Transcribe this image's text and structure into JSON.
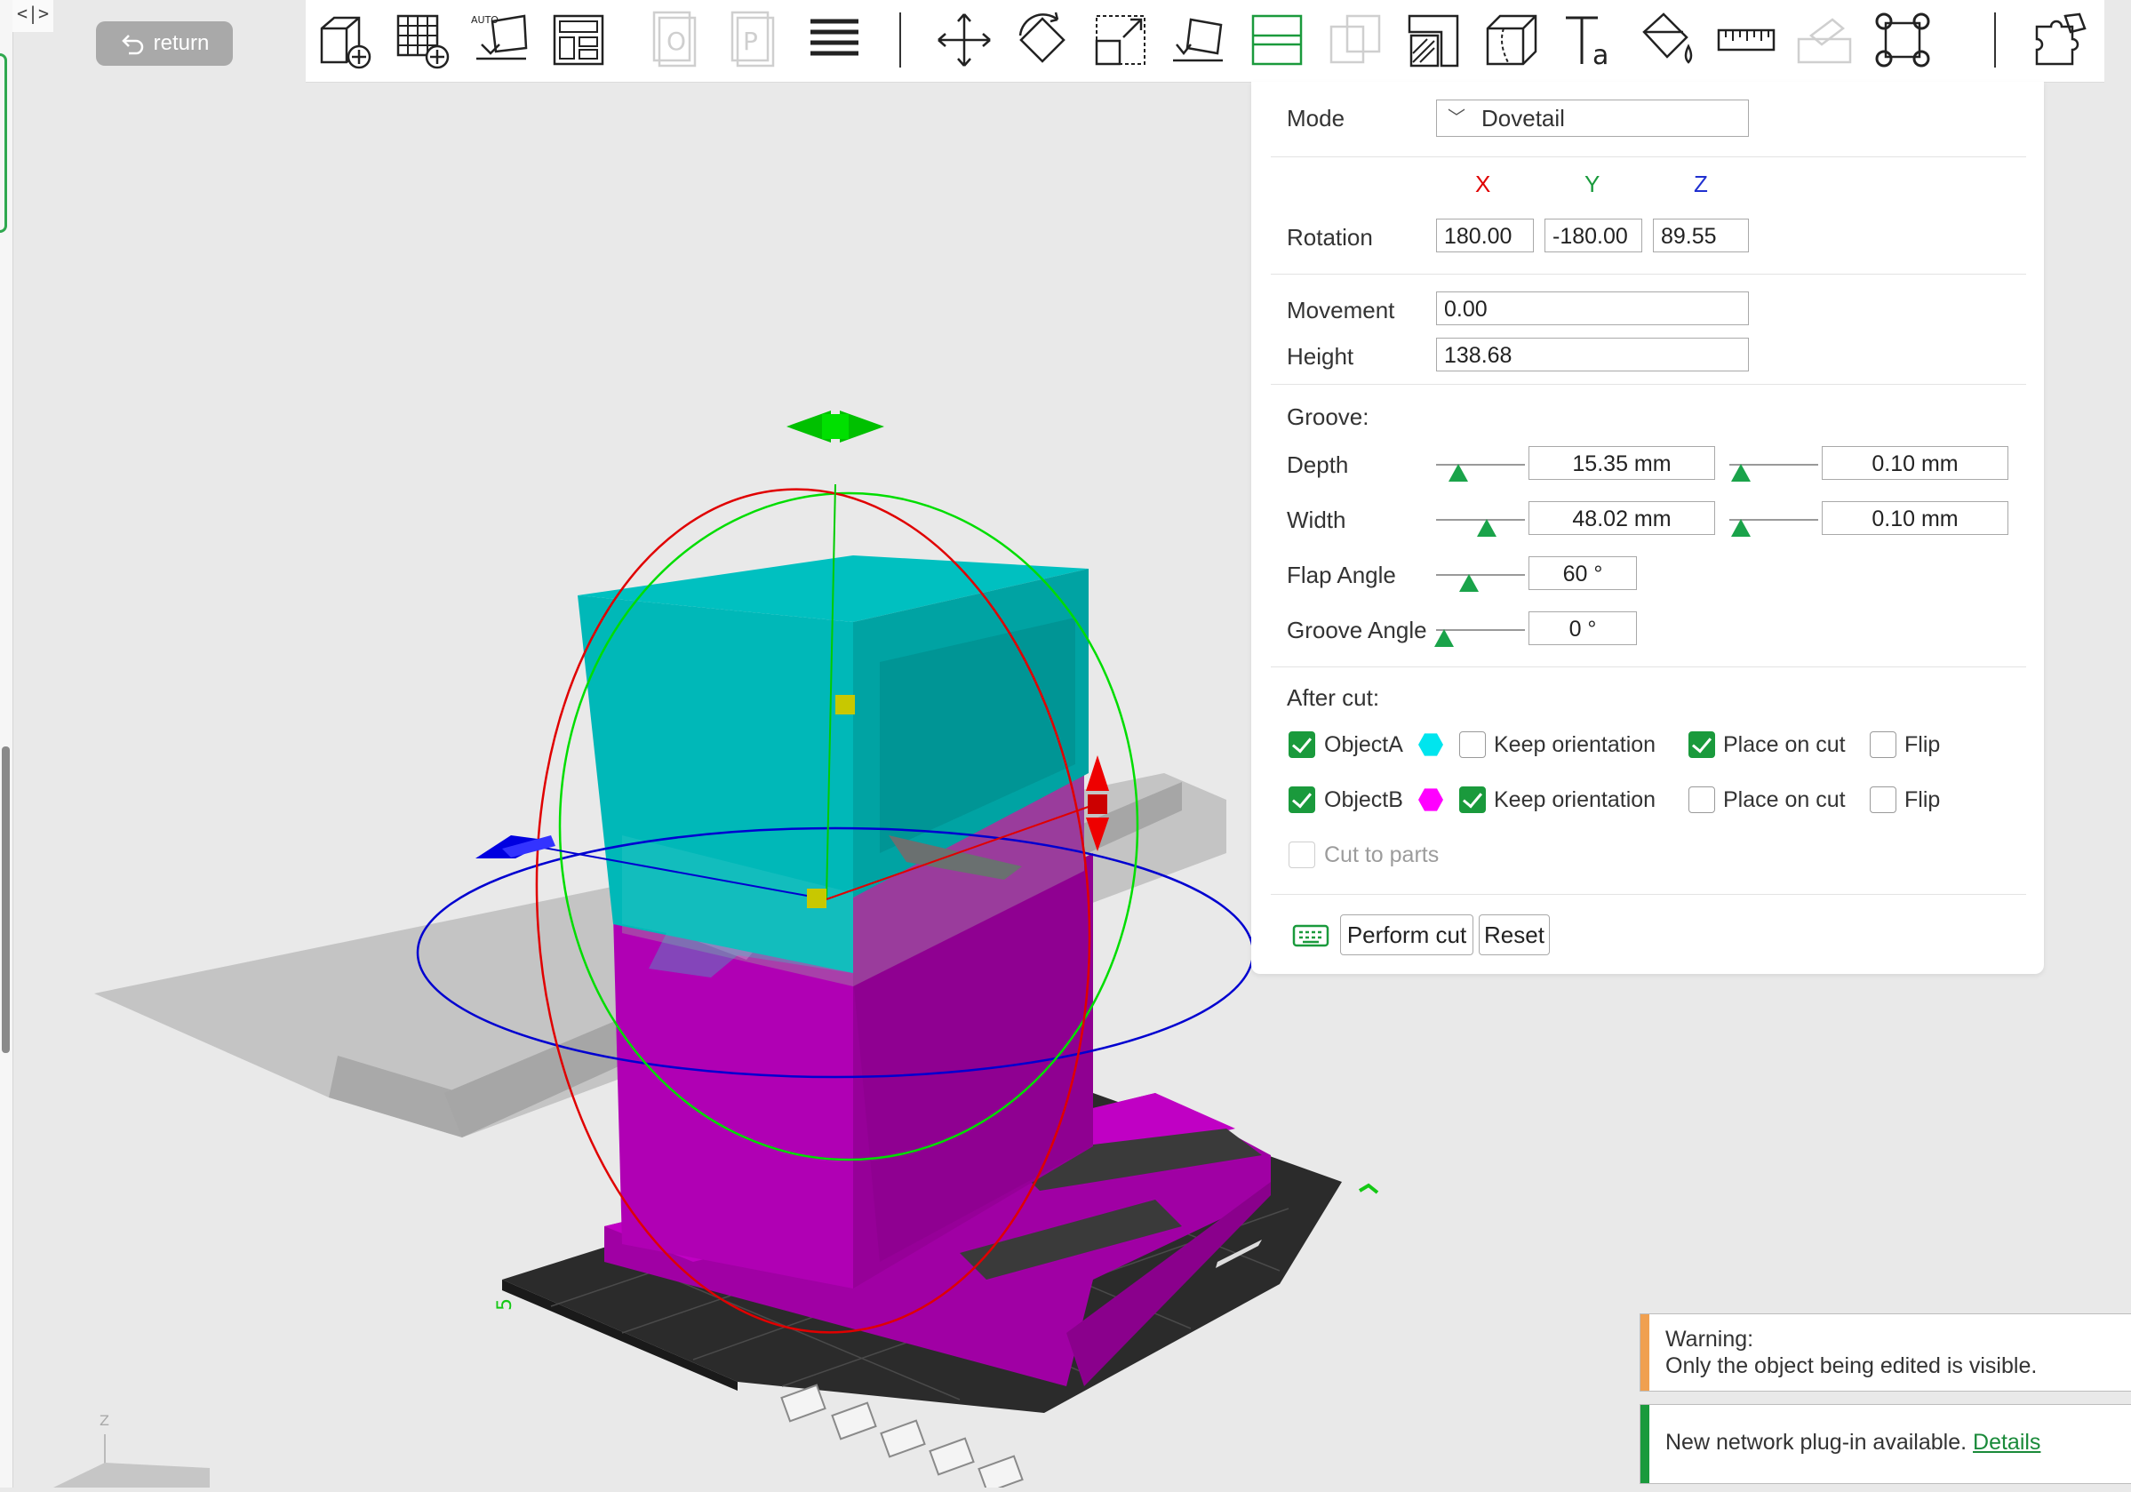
{
  "sidebar": {
    "collapse_glyph": "<|>"
  },
  "header": {
    "return_label": "return"
  },
  "toolbar": {
    "icons": [
      "add-object-icon",
      "add-plate-icon",
      "auto-orient-icon",
      "arrange-icon",
      "split-objects-icon",
      "split-parts-icon",
      "layers-icon",
      "move-icon",
      "rotate-icon",
      "scale-icon",
      "lay-on-face-icon",
      "cut-icon",
      "mesh-boolean-icon",
      "support-painting-icon",
      "seam-painting-icon",
      "text-icon",
      "color-painting-icon",
      "measure-icon",
      "assembly-icon",
      "brim-ears-icon",
      "puzzle-icon"
    ],
    "auto_text": "AUTO"
  },
  "cut_panel": {
    "mode_label": "Mode",
    "mode_value": "Dovetail",
    "axes": {
      "x": "X",
      "y": "Y",
      "z": "Z"
    },
    "rotation_label": "Rotation",
    "rotation": {
      "x": "180.00",
      "y": "-180.00",
      "z": "89.55"
    },
    "movement_label": "Movement",
    "movement_value": "0.00",
    "height_label": "Height",
    "height_value": "138.68",
    "groove_title": "Groove:",
    "depth_label": "Depth",
    "depth_value": "15.35  mm",
    "depth_tolerance": "0.10  mm",
    "width_label": "Width",
    "width_value": "48.02  mm",
    "width_tolerance": "0.10  mm",
    "flap_angle_label": "Flap Angle",
    "flap_angle_value": "60 °",
    "groove_angle_label": "Groove Angle",
    "groove_angle_value": "0 °",
    "after_cut_title": "After cut:",
    "object_a": {
      "name": "ObjectA",
      "checked": true,
      "color": "#00e5ee",
      "keep_orientation": false,
      "place_on_cut": true,
      "flip": false
    },
    "object_b": {
      "name": "ObjectB",
      "checked": true,
      "color": "#ff00ff",
      "keep_orientation": true,
      "place_on_cut": false,
      "flip": false
    },
    "keep_orientation_label": "Keep orientation",
    "place_on_cut_label": "Place on cut",
    "flip_label": "Flip",
    "cut_to_parts_label": "Cut to parts",
    "perform_cut_label": "Perform cut",
    "reset_label": "Reset"
  },
  "notifications": {
    "warning_title": "Warning:",
    "warning_text": "Only the object being edited is visible.",
    "plugin_text": "New network plug-in available.",
    "plugin_link": "Details"
  },
  "viewport": {
    "axis_label": "Z",
    "plate_label": "5",
    "colors": {
      "object_a": "#00b8b8",
      "object_b": "#b000b4",
      "plate": "#2b2b2b",
      "gizmo_x": "#e00000",
      "gizmo_y": "#00cc00",
      "gizmo_z": "#0000d0"
    }
  }
}
